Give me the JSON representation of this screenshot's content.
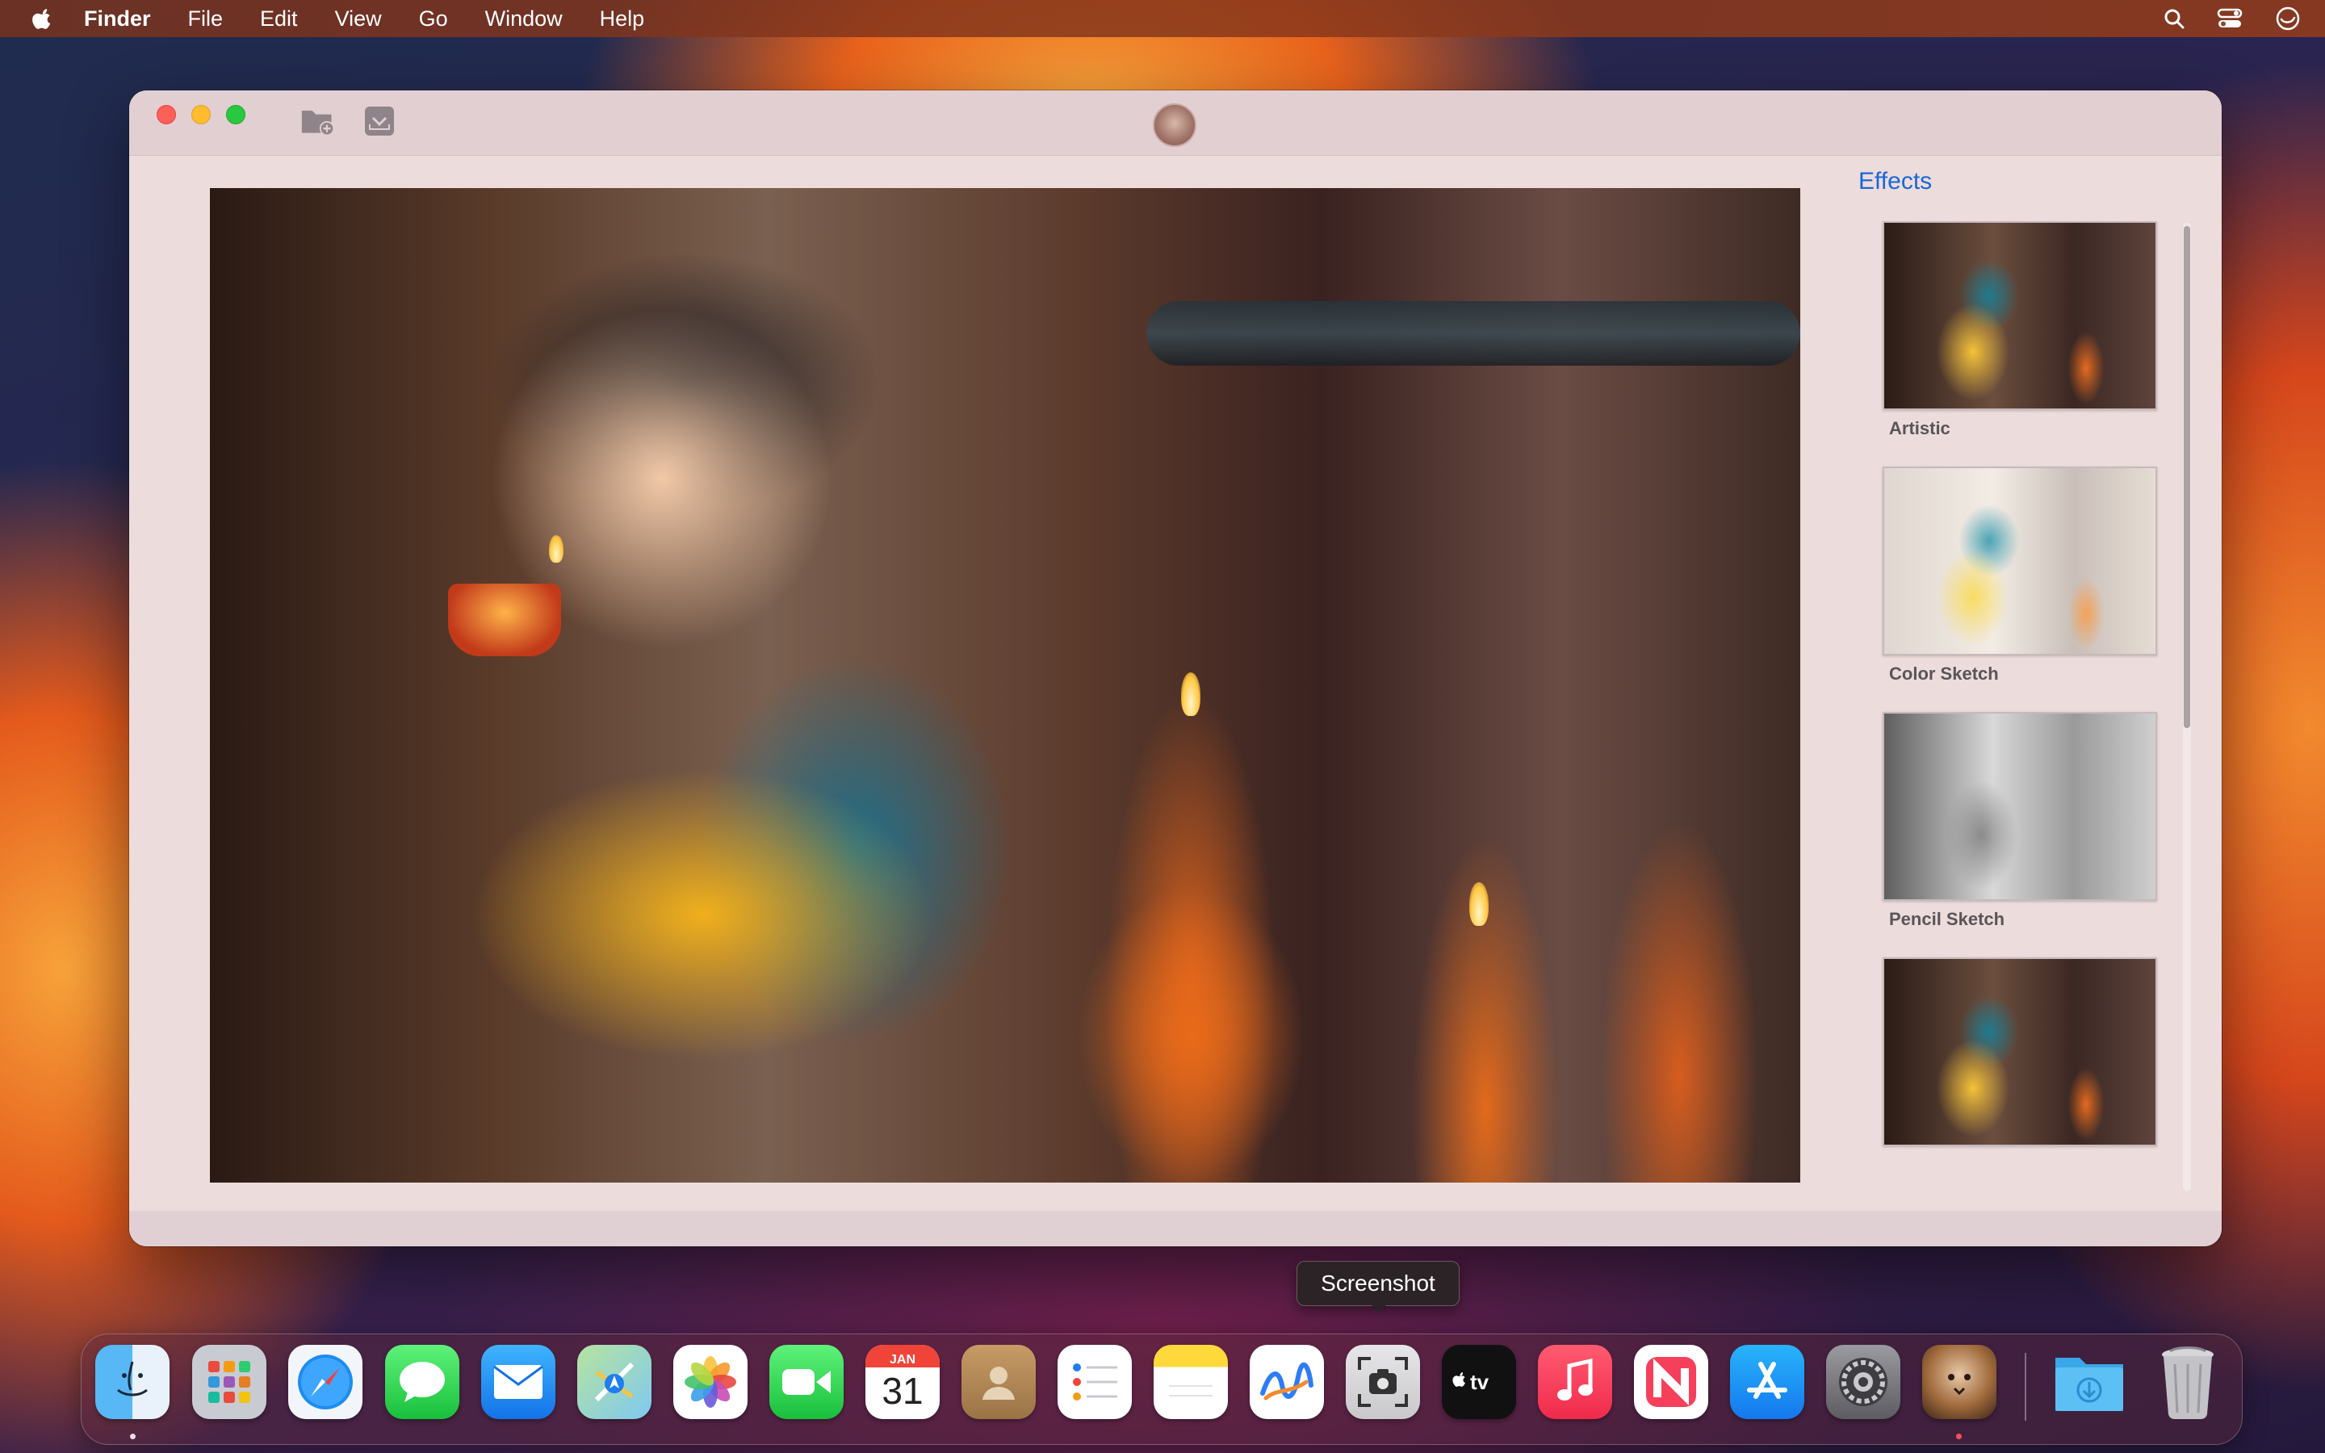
{
  "menubar": {
    "app": "Finder",
    "items": [
      "File",
      "Edit",
      "View",
      "Go",
      "Window",
      "Help"
    ]
  },
  "effects": {
    "title": "Effects",
    "items": [
      {
        "label": "Artistic"
      },
      {
        "label": "Color Sketch"
      },
      {
        "label": "Pencil Sketch"
      },
      {
        "label": ""
      }
    ]
  },
  "tooltip": "Screenshot",
  "dock": {
    "calendar_month": "JAN",
    "calendar_day": "31",
    "apps": [
      "finder-icon",
      "launchpad-icon",
      "safari-icon",
      "messages-icon",
      "mail-icon",
      "maps-icon",
      "photos-icon",
      "facetime-icon",
      "calendar-icon",
      "contacts-icon",
      "reminders-icon",
      "notes-icon",
      "freeform-icon",
      "screenshot-icon",
      "apple-tv-icon",
      "music-icon",
      "news-icon",
      "app-store-icon",
      "system-settings-icon",
      "effects-app-icon",
      "downloads-folder-icon",
      "trash-icon"
    ]
  },
  "colors": {
    "accent": "#1a67d6",
    "window_bg": "#ecdcdc",
    "traffic_red": "#fe5f57",
    "traffic_yellow": "#febc2e",
    "traffic_green": "#28c840"
  }
}
